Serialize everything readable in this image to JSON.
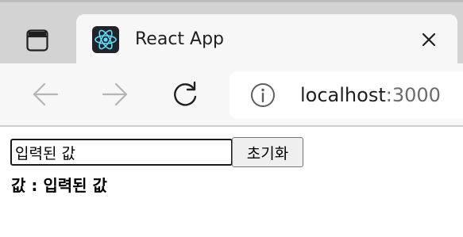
{
  "browser": {
    "tab": {
      "title": "React App",
      "favicon": "react-logo-icon"
    },
    "address_bar": {
      "host": "localhost",
      "port": ":3000"
    },
    "icons": {
      "tab_actions": "tab-actions-icon",
      "close": "close-icon",
      "back": "back-arrow-icon",
      "forward": "forward-arrow-icon",
      "reload": "reload-icon",
      "info": "info-icon"
    },
    "colors": {
      "tabstrip": "#d3d3d3",
      "toolbar": "#f7f7f7",
      "react_cyan": "#61dafb",
      "react_bg": "#20232a"
    }
  },
  "page": {
    "input": {
      "value": "입력된 값"
    },
    "reset_button_label": "초기화",
    "value_label": "값 : ",
    "value_text": "입력된 값"
  }
}
